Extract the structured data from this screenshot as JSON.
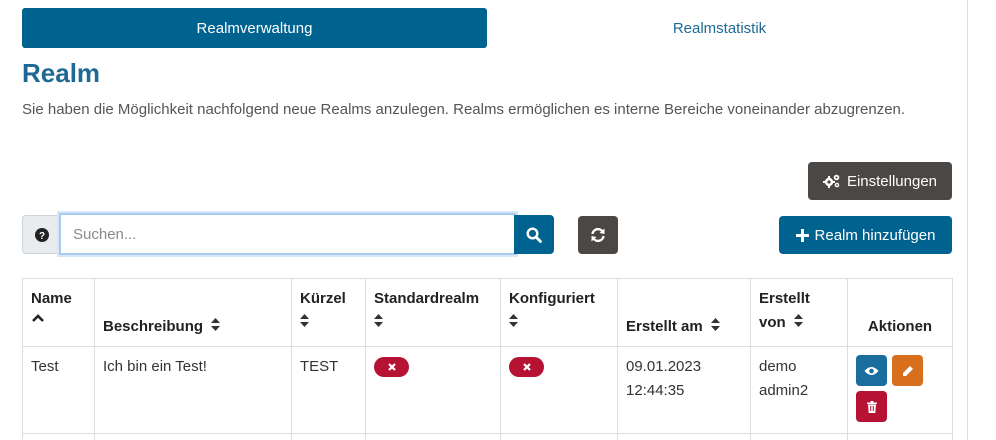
{
  "tabs": {
    "active": "Realmverwaltung",
    "inactive": "Realmstatistik"
  },
  "page": {
    "title": "Realm",
    "description": "Sie haben die Möglichkeit nachfolgend neue Realms anzulegen. Realms ermöglichen es interne Bereiche voneinander abzugrenzen."
  },
  "buttons": {
    "settings": "Einstellungen",
    "add": "Realm hinzufügen"
  },
  "search": {
    "placeholder": "Suchen...",
    "value": ""
  },
  "table": {
    "headers": {
      "name": "Name",
      "description": "Beschreibung",
      "short": "Kürzel",
      "default": "Standardrealm",
      "configured": "Konfiguriert",
      "created_at": "Erstellt am",
      "created_by_1": "Erstellt",
      "created_by_2": "von",
      "actions": "Aktionen"
    },
    "rows": [
      {
        "name": "Test",
        "description": "Ich bin ein Test!",
        "short": "TEST",
        "default": false,
        "configured": false,
        "created_date": "09.01.2023",
        "created_time": "12:44:35",
        "created_by_1": "demo",
        "created_by_2": "admin2"
      }
    ]
  },
  "icons": {
    "help": "question-circle-icon",
    "search": "search-icon",
    "refresh": "refresh-icon",
    "settings": "cogs-icon",
    "add": "plus-icon",
    "sort": "sort-icon",
    "sort_up": "chevron-up-icon",
    "false_badge": "x-icon",
    "view": "eye-icon",
    "edit": "pencil-icon",
    "delete": "trash-icon"
  },
  "colors": {
    "primary": "#00628f",
    "dark": "#4a4745",
    "danger": "#b51234",
    "warning": "#d76f1c",
    "heading": "#1f6a94"
  }
}
